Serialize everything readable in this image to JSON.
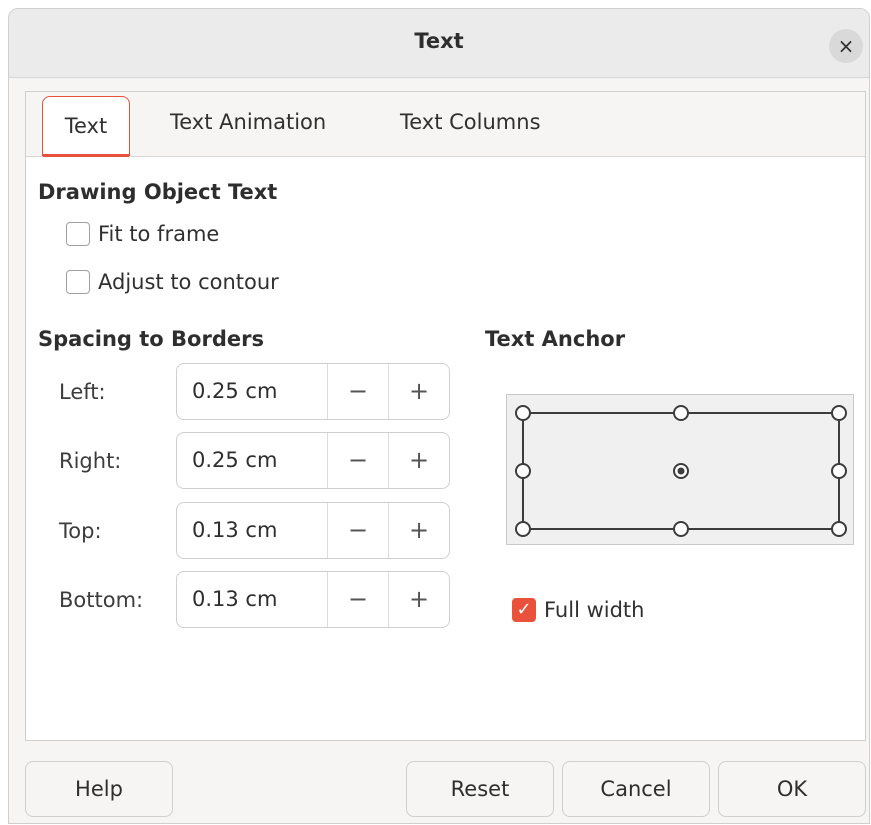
{
  "dialog": {
    "title": "Text",
    "close_glyph": "×"
  },
  "tabs": [
    {
      "label": "Text",
      "active": true
    },
    {
      "label": "Text Animation",
      "active": false
    },
    {
      "label": "Text Columns",
      "active": false
    }
  ],
  "drawing_object_text": {
    "heading": "Drawing Object Text",
    "fit_to_frame": {
      "label": "Fit to frame",
      "checked": false
    },
    "adjust_to_contour": {
      "label": "Adjust to contour",
      "checked": false
    }
  },
  "spacing": {
    "heading": "Spacing to Borders",
    "rows": [
      {
        "label": "Left:",
        "value": "0.25 cm"
      },
      {
        "label": "Right:",
        "value": "0.25 cm"
      },
      {
        "label": "Top:",
        "value": "0.13 cm"
      },
      {
        "label": "Bottom:",
        "value": "0.13 cm"
      }
    ],
    "minus_glyph": "−",
    "plus_glyph": "+"
  },
  "text_anchor": {
    "heading": "Text Anchor",
    "selected": "center",
    "full_width": {
      "label": "Full width",
      "checked": true
    }
  },
  "footer": {
    "help": "Help",
    "reset": "Reset",
    "cancel": "Cancel",
    "ok": "OK"
  },
  "colors": {
    "accent": "#e9513a"
  }
}
